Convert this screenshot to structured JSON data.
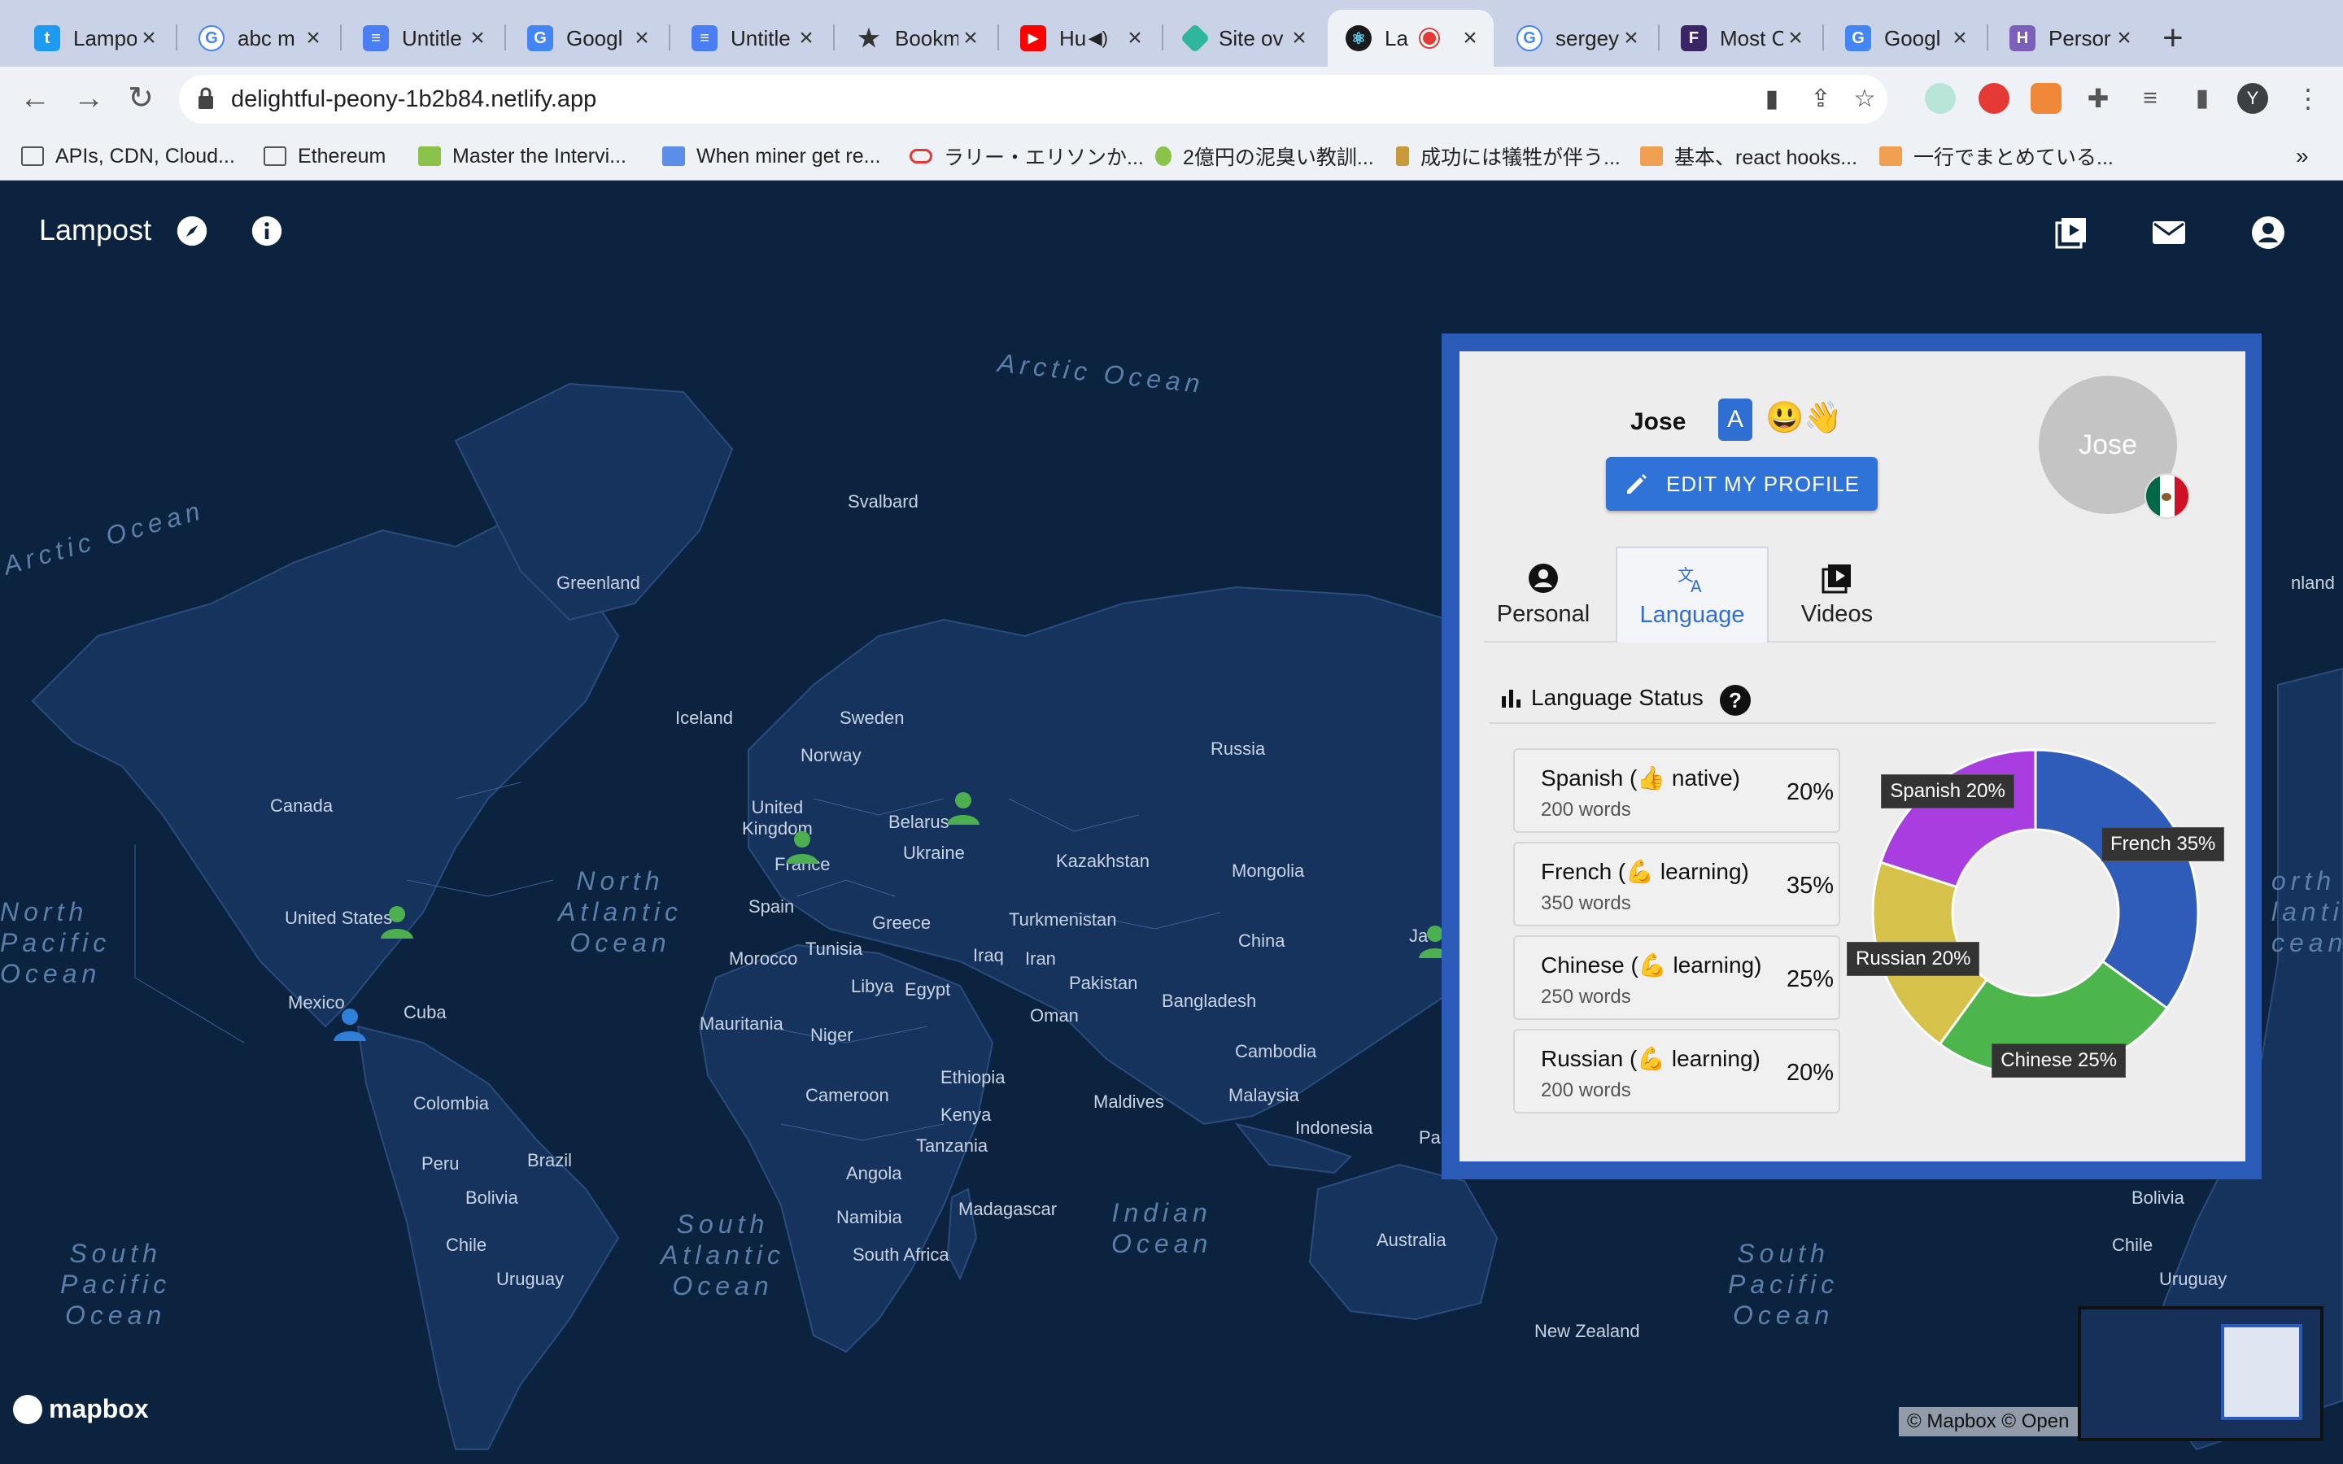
{
  "browser": {
    "tabs": [
      {
        "label": "Lampo",
        "icon": "twitter-icon",
        "color": "#1d9bf0"
      },
      {
        "label": "abc m",
        "icon": "google-icon",
        "color": "#4285f4"
      },
      {
        "label": "Untitle",
        "icon": "docs-icon",
        "color": "#4a7ef5"
      },
      {
        "label": "Googl",
        "icon": "translate-icon",
        "color": "#4285f4"
      },
      {
        "label": "Untitle",
        "icon": "docs-icon",
        "color": "#4a7ef5"
      },
      {
        "label": "Bookm",
        "icon": "star-icon",
        "color": "#333333"
      },
      {
        "label": "Hu",
        "icon": "youtube-icon",
        "color": "#ff0000"
      },
      {
        "label": "Site ov",
        "icon": "netlify-icon",
        "color": "#2fb79e"
      },
      {
        "label": "La",
        "icon": "react-icon",
        "color": "#1a1a1a"
      },
      {
        "label": "sergey",
        "icon": "google-icon",
        "color": "#4285f4"
      },
      {
        "label": "Most C",
        "icon": "f-icon",
        "color": "#3a2566"
      },
      {
        "label": "Googl",
        "icon": "translate-icon",
        "color": "#4285f4"
      },
      {
        "label": "Persor",
        "icon": "h-icon",
        "color": "#7b5fb8"
      }
    ],
    "url": "delightful-peony-1b2b84.netlify.app",
    "profile_initial": "Y",
    "bookmarks": [
      {
        "label": "APIs, CDN, Cloud..."
      },
      {
        "label": "Ethereum"
      },
      {
        "label": "Master the Intervi..."
      },
      {
        "label": "When miner get re..."
      },
      {
        "label": "ラリー・エリソンか..."
      },
      {
        "label": "2億円の泥臭い教訓..."
      },
      {
        "label": "成功には犠牲が伴う..."
      },
      {
        "label": "基本、react hooks..."
      },
      {
        "label": "一行でまとめている..."
      }
    ]
  },
  "app": {
    "brand": "Lampost"
  },
  "map": {
    "labels": {
      "svalbard": "Svalbard",
      "greenland": "Greenland",
      "greenland_right": "nland",
      "iceland": "Iceland",
      "sweden": "Sweden",
      "norway": "Norway",
      "russia": "Russia",
      "canada": "Canada",
      "united_kingdom": "United\nKingdom",
      "belarus": "Belarus",
      "ukraine": "Ukraine",
      "france": "France",
      "kazakhstan": "Kazakhstan",
      "mongolia": "Mongolia",
      "united_states": "United States",
      "spain": "Spain",
      "greece": "Greece",
      "turkmenistan": "Turkmenistan",
      "china": "China",
      "morocco": "Morocco",
      "tunisia": "Tunisia",
      "iraq": "Iraq",
      "iran": "Iran",
      "mexico": "Mexico",
      "cuba": "Cuba",
      "libya": "Libya",
      "egypt": "Egypt",
      "pakistan": "Pakistan",
      "bangladesh": "Bangladesh",
      "mauritania": "Mauritania",
      "niger": "Niger",
      "oman": "Oman",
      "cambodia": "Cambodia",
      "ethiopia": "Ethiopia",
      "malaysia": "Malaysia",
      "colombia": "Colombia",
      "cameroon": "Cameroon",
      "maldives": "Maldives",
      "kenya": "Kenya",
      "indonesia": "Indonesia",
      "peru": "Peru",
      "brazil": "Brazil",
      "tanzania": "Tanzania",
      "angola": "Angola",
      "bolivia": "Bolivia",
      "bolivia_right": "Bolivia",
      "madagascar": "Madagascar",
      "namibia": "Namibia",
      "chile": "Chile",
      "chile_right": "Chile",
      "south_africa": "South Africa",
      "australia": "Australia",
      "uruguay": "Uruguay",
      "uruguay_right": "Uruguay",
      "new_zealand": "New Zealand",
      "ja": "Ja",
      "pap": "Pap"
    },
    "oceans": {
      "arctic_top": "Arctic Ocean",
      "arctic_left": "Arctic Ocean",
      "north_atlantic": "North\nAtlantic\nOcean",
      "north_pacific": "North\nPacific\nOcean",
      "north_atlantic_right": "orth\nlantic\ncean",
      "south_atlantic": "South\nAtlantic\nOcean",
      "south_pacific": "South\nPacific\nOcean",
      "south_pacific_right": "South\nPacific\nOcean",
      "indian": "Indian\nOcean"
    },
    "marker_colors": {
      "green": "#4caf50",
      "blue": "#2f7fd8"
    },
    "mapbox_logo": "mapbox",
    "attribution": "© Mapbox © Open"
  },
  "profile": {
    "name": "Jose",
    "level_badge": "A",
    "emojis": "😃👋",
    "edit_button": "EDIT MY PROFILE",
    "avatar_text": "Jose",
    "country_flag": "mexico-flag",
    "tabs": [
      {
        "label": "Personal",
        "icon": "person-icon",
        "active": false
      },
      {
        "label": "Language",
        "icon": "translate-icon",
        "active": true
      },
      {
        "label": "Videos",
        "icon": "video-library-icon",
        "active": false
      }
    ],
    "section_title": "Language Status",
    "help_icon": "?",
    "languages": [
      {
        "name": "Spanish (👍 native)",
        "words": "200 words",
        "percent": "20%"
      },
      {
        "name": "French (💪 learning)",
        "words": "350 words",
        "percent": "35%"
      },
      {
        "name": "Chinese (💪 learning)",
        "words": "250 words",
        "percent": "25%"
      },
      {
        "name": "Russian (💪 learning)",
        "words": "200 words",
        "percent": "20%"
      }
    ]
  },
  "chart_data": {
    "type": "pie",
    "categories": [
      "French",
      "Chinese",
      "Russian",
      "Spanish"
    ],
    "values": [
      35,
      25,
      20,
      20
    ],
    "labels": [
      "French 35%",
      "Chinese 25%",
      "Russian 20%",
      "Spanish 20%"
    ],
    "colors": [
      "#2f5cb8",
      "#4cb64c",
      "#d6c24a",
      "#a83de0"
    ],
    "donut": true
  }
}
